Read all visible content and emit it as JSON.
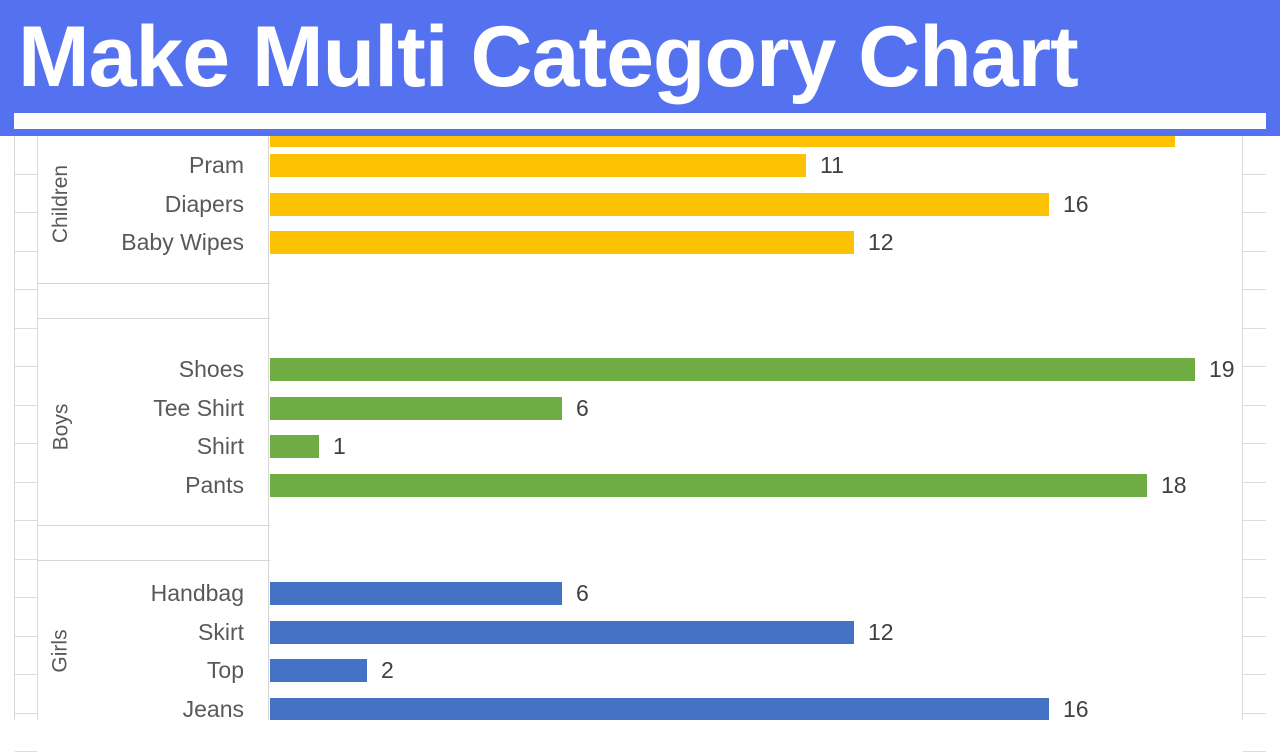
{
  "banner": {
    "title": "Make Multi Category Chart",
    "background_color": "#5472f0",
    "text_color": "#ffffff",
    "strip_color": "#fdfdfa"
  },
  "chart_data": {
    "type": "bar",
    "orientation": "horizontal",
    "title": "Make Multi Category Chart",
    "xlabel": "",
    "ylabel": "",
    "grid": false,
    "legend": "none",
    "xlim": [
      0,
      19
    ],
    "value_labels": true,
    "groups": [
      {
        "name": "Children",
        "color": "#fcc203",
        "categories": [
          "Pram",
          "Diapers",
          "Baby Wipes"
        ],
        "values": [
          11,
          16,
          12
        ]
      },
      {
        "name": "Boys",
        "color": "#6fac44",
        "categories": [
          "Shoes",
          "Tee Shirt",
          "Shirt",
          "Pants"
        ],
        "values": [
          19,
          6,
          1,
          18
        ]
      },
      {
        "name": "Girls",
        "color": "#4472c4",
        "categories": [
          "Handbag",
          "Skirt",
          "Top",
          "Jeans"
        ],
        "values": [
          6,
          12,
          2,
          16
        ]
      }
    ]
  },
  "groups_view": {
    "children": {
      "label": "Children",
      "rows": [
        {
          "label": "Pram",
          "value": "11"
        },
        {
          "label": "Diapers",
          "value": "16"
        },
        {
          "label": "Baby Wipes",
          "value": "12"
        }
      ]
    },
    "boys": {
      "label": "Boys",
      "rows": [
        {
          "label": "Shoes",
          "value": "19"
        },
        {
          "label": "Tee Shirt",
          "value": "6"
        },
        {
          "label": "Shirt",
          "value": "1"
        },
        {
          "label": "Pants",
          "value": "18"
        }
      ]
    },
    "girls": {
      "label": "Girls",
      "rows": [
        {
          "label": "Handbag",
          "value": "6"
        },
        {
          "label": "Skirt",
          "value": "12"
        },
        {
          "label": "Top",
          "value": "2"
        },
        {
          "label": "Jeans",
          "value": "16"
        }
      ]
    }
  }
}
